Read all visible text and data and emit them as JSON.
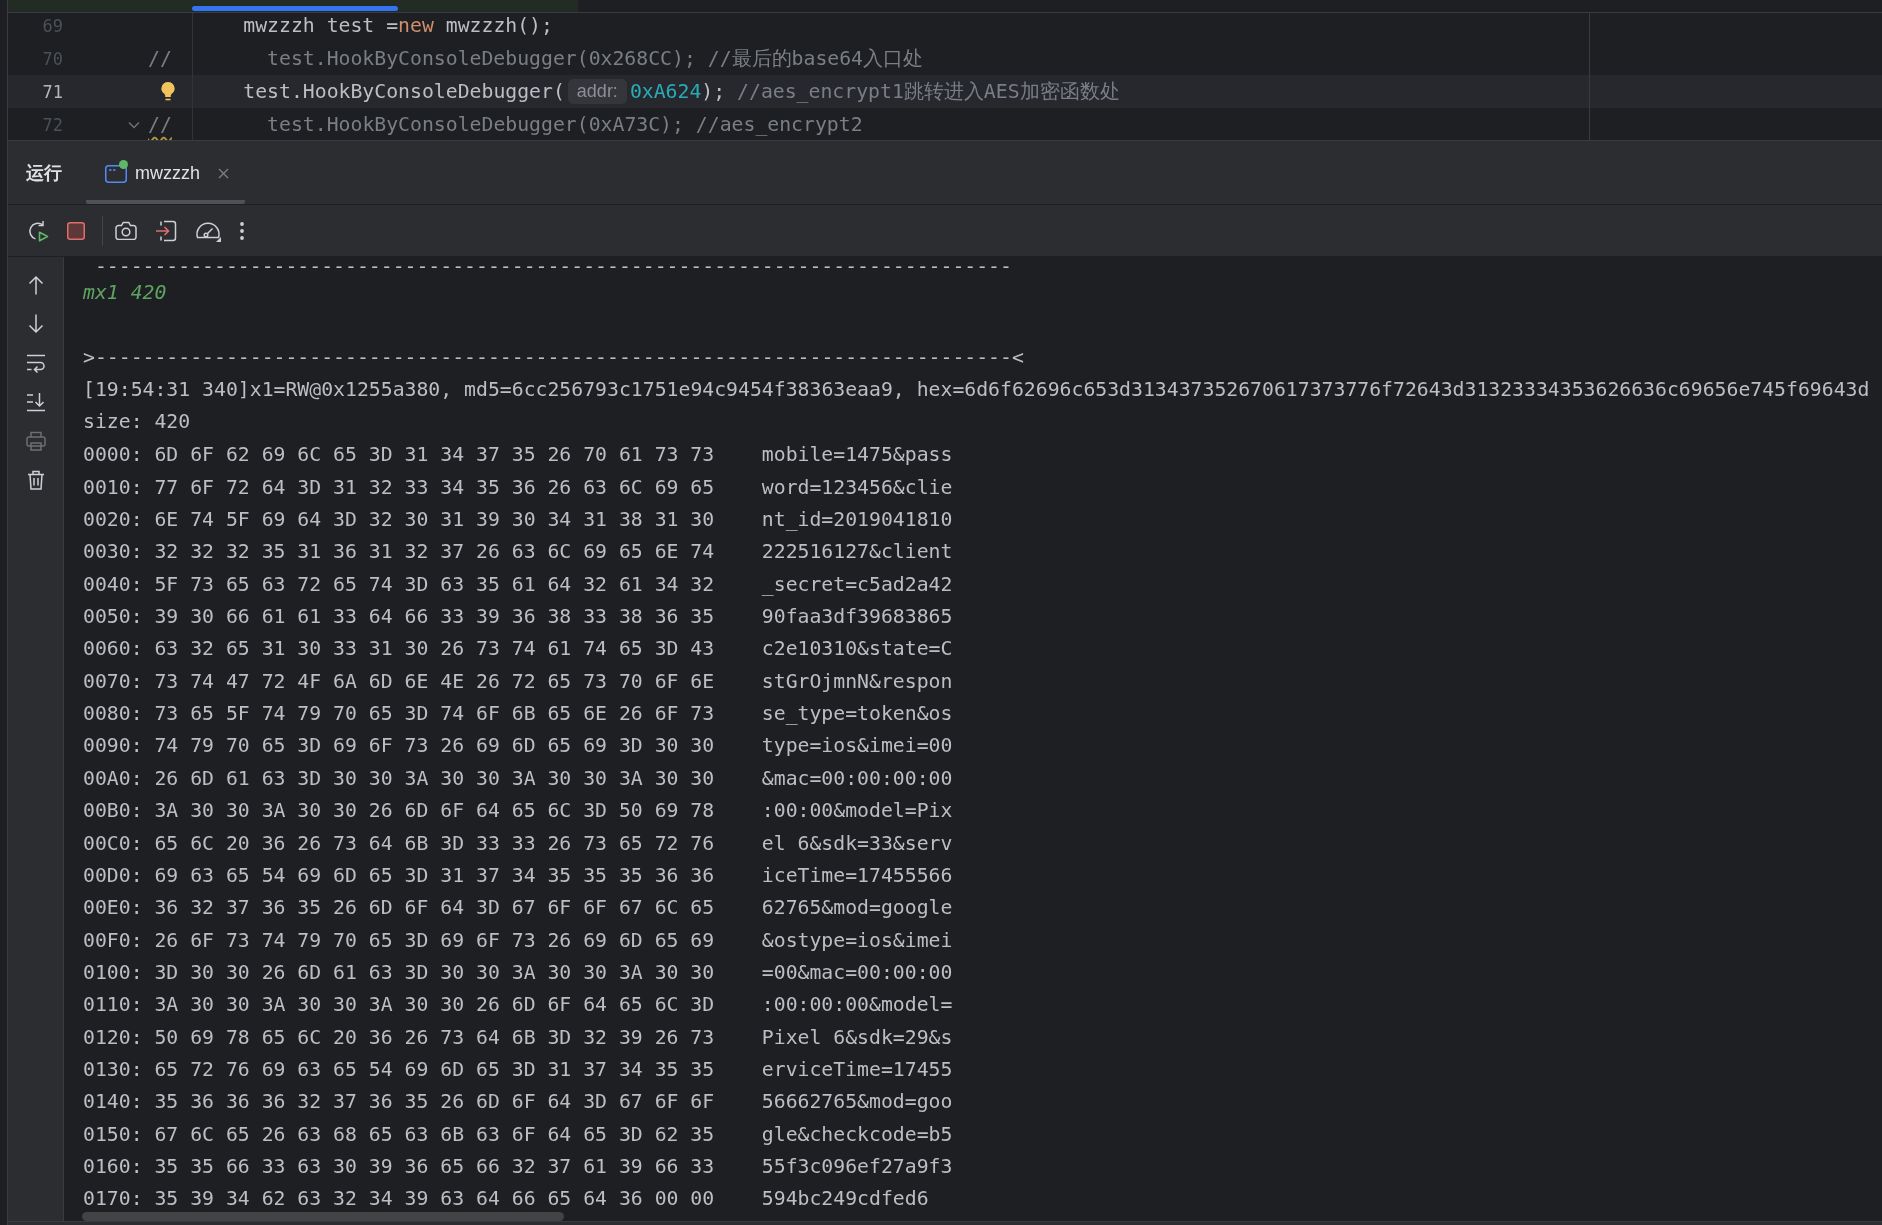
{
  "editor": {
    "lines": [
      {
        "number": "69",
        "current": false,
        "bulb": false,
        "fold_marker": false,
        "segments": [
          {
            "kind": "code",
            "text": "        mwzzzh test ="
          },
          {
            "kind": "keyword",
            "text": "new"
          },
          {
            "kind": "code",
            "text": " mwzzzh();"
          }
        ]
      },
      {
        "number": "70",
        "current": false,
        "bulb": false,
        "fold_marker": false,
        "segments": [
          {
            "kind": "comment",
            "text": "//        test.HookByConsoleDebugger(0x268CC); //最后的base64入口处"
          }
        ]
      },
      {
        "number": "71",
        "current": true,
        "bulb": true,
        "fold_marker": false,
        "segments": [
          {
            "kind": "code",
            "text": "        test.HookByConsoleDebugger("
          },
          {
            "kind": "hint",
            "text": "addr:"
          },
          {
            "kind": "number",
            "text": "0xA624"
          },
          {
            "kind": "code",
            "text": "); "
          },
          {
            "kind": "comment",
            "text": "//aes_encrypt1跳转进入AES加密函数处"
          }
        ]
      },
      {
        "number": "72",
        "current": false,
        "bulb": false,
        "fold_marker": true,
        "segments": [
          {
            "kind": "warning",
            "text": "//"
          },
          {
            "kind": "comment",
            "text": "        test.HookByConsoleDebugger(0xA73C); //aes_encrypt2"
          }
        ]
      }
    ]
  },
  "run_panel": {
    "title": "运行",
    "tabs": [
      {
        "label": "mwzzzh",
        "selected": true,
        "running": true
      }
    ],
    "toolbar_groups": [
      [
        {
          "kind": "rerun",
          "disabled": false
        },
        {
          "kind": "stop",
          "disabled": false
        }
      ],
      [
        {
          "kind": "camera",
          "disabled": false
        },
        {
          "kind": "attach",
          "disabled": false
        },
        {
          "kind": "gauge",
          "disabled": false
        },
        {
          "kind": "more",
          "disabled": false
        }
      ]
    ],
    "side_toolbar": [
      {
        "kind": "up",
        "disabled": false
      },
      {
        "kind": "down",
        "disabled": false
      },
      {
        "kind": "wrap",
        "disabled": false
      },
      {
        "kind": "scroll_end",
        "disabled": false
      },
      {
        "kind": "print",
        "disabled": true
      },
      {
        "kind": "trash",
        "disabled": false
      }
    ],
    "console": {
      "lines": [
        {
          "kind": "plain",
          "text": "-----------------------------------------------------------------------------"
        },
        {
          "kind": "info",
          "text": "mx1 420"
        },
        {
          "kind": "blank"
        },
        {
          "kind": "plain",
          "text": ">-----------------------------------------------------------------------------<"
        },
        {
          "kind": "plain",
          "text": "[19:54:31 340]x1=RW@0x1255a380, md5=6cc256793c1751e94c9454f38363eaa9, hex=6d6f62696c653d313437352670617373776f72643d31323334353626636c69656e745f69643d"
        },
        {
          "kind": "plain",
          "text": "size: 420"
        },
        {
          "kind": "hex",
          "offset": "0000:",
          "bytes": "6D 6F 62 69 6C 65 3D 31 34 37 35 26 70 61 73 73",
          "ascii": "mobile=1475&pass"
        },
        {
          "kind": "hex",
          "offset": "0010:",
          "bytes": "77 6F 72 64 3D 31 32 33 34 35 36 26 63 6C 69 65",
          "ascii": "word=123456&clie"
        },
        {
          "kind": "hex",
          "offset": "0020:",
          "bytes": "6E 74 5F 69 64 3D 32 30 31 39 30 34 31 38 31 30",
          "ascii": "nt_id=2019041810"
        },
        {
          "kind": "hex",
          "offset": "0030:",
          "bytes": "32 32 32 35 31 36 31 32 37 26 63 6C 69 65 6E 74",
          "ascii": "222516127&client"
        },
        {
          "kind": "hex",
          "offset": "0040:",
          "bytes": "5F 73 65 63 72 65 74 3D 63 35 61 64 32 61 34 32",
          "ascii": "_secret=c5ad2a42"
        },
        {
          "kind": "hex",
          "offset": "0050:",
          "bytes": "39 30 66 61 61 33 64 66 33 39 36 38 33 38 36 35",
          "ascii": "90faa3df39683865"
        },
        {
          "kind": "hex",
          "offset": "0060:",
          "bytes": "63 32 65 31 30 33 31 30 26 73 74 61 74 65 3D 43",
          "ascii": "c2e10310&state=C"
        },
        {
          "kind": "hex",
          "offset": "0070:",
          "bytes": "73 74 47 72 4F 6A 6D 6E 4E 26 72 65 73 70 6F 6E",
          "ascii": "stGrOjmnN&respon"
        },
        {
          "kind": "hex",
          "offset": "0080:",
          "bytes": "73 65 5F 74 79 70 65 3D 74 6F 6B 65 6E 26 6F 73",
          "ascii": "se_type=token&os"
        },
        {
          "kind": "hex",
          "offset": "0090:",
          "bytes": "74 79 70 65 3D 69 6F 73 26 69 6D 65 69 3D 30 30",
          "ascii": "type=ios&imei=00"
        },
        {
          "kind": "hex",
          "offset": "00A0:",
          "bytes": "26 6D 61 63 3D 30 30 3A 30 30 3A 30 30 3A 30 30",
          "ascii": "&mac=00:00:00:00"
        },
        {
          "kind": "hex",
          "offset": "00B0:",
          "bytes": "3A 30 30 3A 30 30 26 6D 6F 64 65 6C 3D 50 69 78",
          "ascii": ":00:00&model=Pix"
        },
        {
          "kind": "hex",
          "offset": "00C0:",
          "bytes": "65 6C 20 36 26 73 64 6B 3D 33 33 26 73 65 72 76",
          "ascii": "el 6&sdk=33&serv"
        },
        {
          "kind": "hex",
          "offset": "00D0:",
          "bytes": "69 63 65 54 69 6D 65 3D 31 37 34 35 35 35 36 36",
          "ascii": "iceTime=17455566"
        },
        {
          "kind": "hex",
          "offset": "00E0:",
          "bytes": "36 32 37 36 35 26 6D 6F 64 3D 67 6F 6F 67 6C 65",
          "ascii": "62765&mod=google"
        },
        {
          "kind": "hex",
          "offset": "00F0:",
          "bytes": "26 6F 73 74 79 70 65 3D 69 6F 73 26 69 6D 65 69",
          "ascii": "&ostype=ios&imei"
        },
        {
          "kind": "hex",
          "offset": "0100:",
          "bytes": "3D 30 30 26 6D 61 63 3D 30 30 3A 30 30 3A 30 30",
          "ascii": "=00&mac=00:00:00"
        },
        {
          "kind": "hex",
          "offset": "0110:",
          "bytes": "3A 30 30 3A 30 30 3A 30 30 26 6D 6F 64 65 6C 3D",
          "ascii": ":00:00:00&model="
        },
        {
          "kind": "hex",
          "offset": "0120:",
          "bytes": "50 69 78 65 6C 20 36 26 73 64 6B 3D 32 39 26 73",
          "ascii": "Pixel 6&sdk=29&s"
        },
        {
          "kind": "hex",
          "offset": "0130:",
          "bytes": "65 72 76 69 63 65 54 69 6D 65 3D 31 37 34 35 35",
          "ascii": "erviceTime=17455"
        },
        {
          "kind": "hex",
          "offset": "0140:",
          "bytes": "35 36 36 36 32 37 36 35 26 6D 6F 64 3D 67 6F 6F",
          "ascii": "56662765&mod=goo"
        },
        {
          "kind": "hex",
          "offset": "0150:",
          "bytes": "67 6C 65 26 63 68 65 63 6B 63 6F 64 65 3D 62 35",
          "ascii": "gle&checkcode=b5"
        },
        {
          "kind": "hex",
          "offset": "0160:",
          "bytes": "35 35 66 33 63 30 39 36 65 66 32 37 61 39 66 33",
          "ascii": "55f3c096ef27a9f3"
        },
        {
          "kind": "hex",
          "offset": "0170:",
          "bytes": "35 39 34 62 63 32 34 39 63 64 66 65 64 36 00 00",
          "ascii": "594bc249cdfed6"
        }
      ]
    }
  }
}
